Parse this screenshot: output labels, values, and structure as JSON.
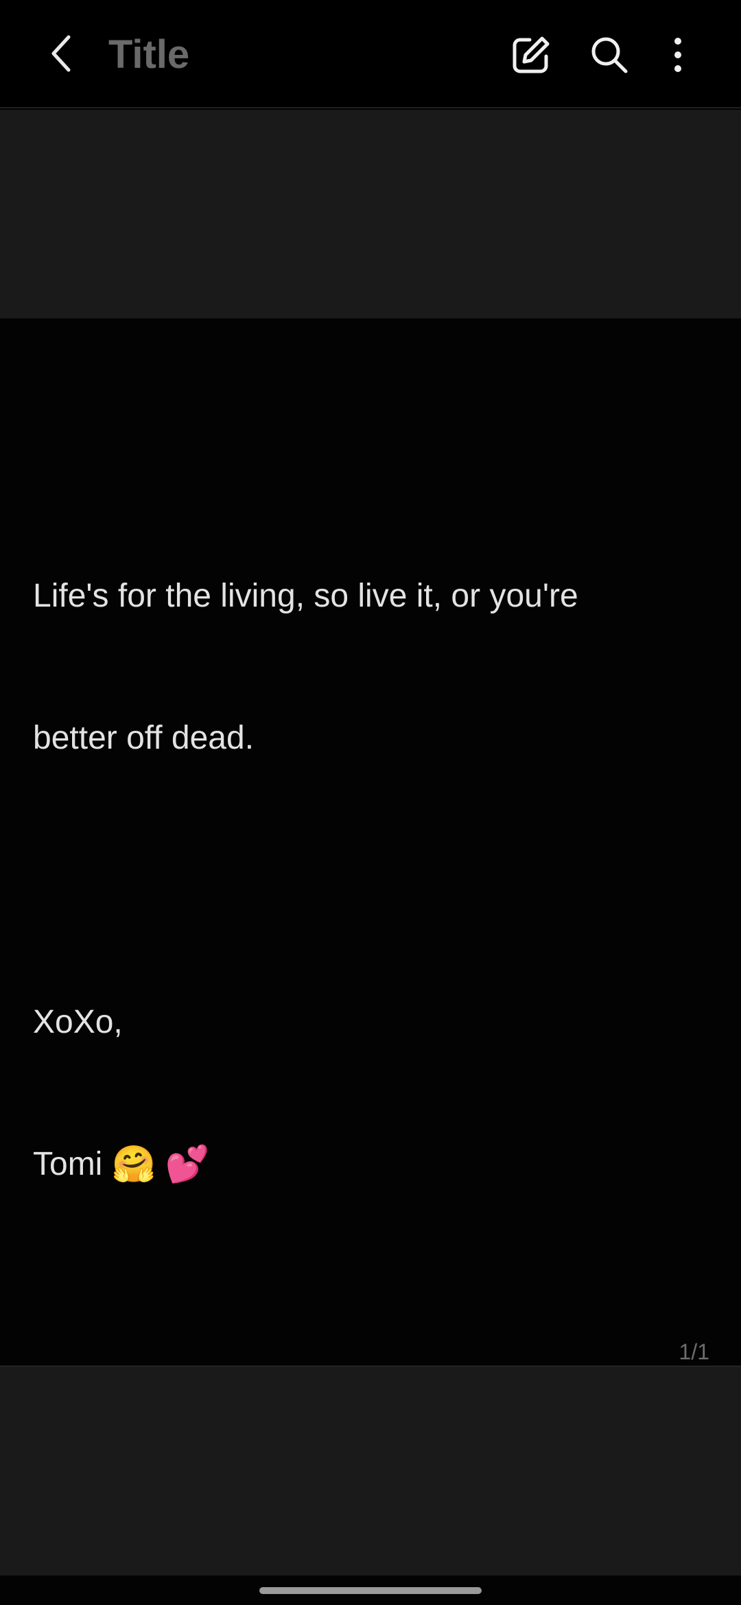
{
  "header": {
    "title": "Title",
    "back_icon": "chevron-left-icon",
    "edit_icon": "edit-icon",
    "search_icon": "search-icon",
    "more_icon": "more-vert-icon"
  },
  "note": {
    "line1": "Life's for the living, so live it, or you're",
    "line2": "better off dead.",
    "line3": "XoXo,",
    "line4_text": "Tomi ",
    "emoji1": "🤗",
    "emoji2": "💕"
  },
  "page_indicator": "1/1",
  "colors": {
    "background": "#030303",
    "bar": "#000000",
    "band": "#1a1a1a",
    "title_text": "#6a6a6a",
    "body_text": "#e3e3e3"
  }
}
